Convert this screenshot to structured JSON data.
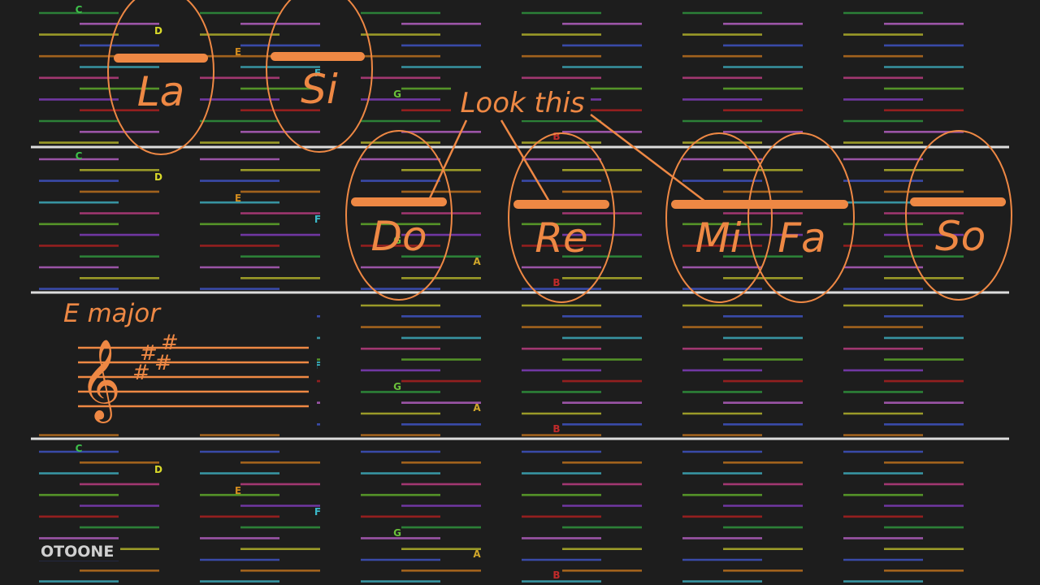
{
  "brand": "OTOONE",
  "key_signature": {
    "label": "E major",
    "clef_glyph": "𝄞",
    "accidentals": [
      "#",
      "#",
      "#",
      "#"
    ]
  },
  "annotation": {
    "text": "Look this"
  },
  "solfege": [
    "La",
    "Si",
    "Do",
    "Re",
    "Mi",
    "Fa",
    "So"
  ],
  "note_letters": [
    "C",
    "D",
    "E",
    "F",
    "G",
    "A",
    "B"
  ],
  "colors": {
    "background": "#1d1d1d",
    "accent": "#ee8844",
    "divider": "#dddddd",
    "brand_text": "#d0d0d0",
    "line_colors": [
      "#2e8b3a",
      "#a85ab5",
      "#a8a82a",
      "#3d4fb8",
      "#b06a1e",
      "#3aa0b0",
      "#b03a7a",
      "#5aa02a",
      "#7a3ab0",
      "#a02020"
    ],
    "letter_colors": {
      "C": "#3ec04a",
      "D": "#d9d92a",
      "E": "#d08a1e",
      "F": "#3ab8c8",
      "G": "#6ac03a",
      "A": "#d0a62a",
      "B": "#c02a2a"
    }
  }
}
